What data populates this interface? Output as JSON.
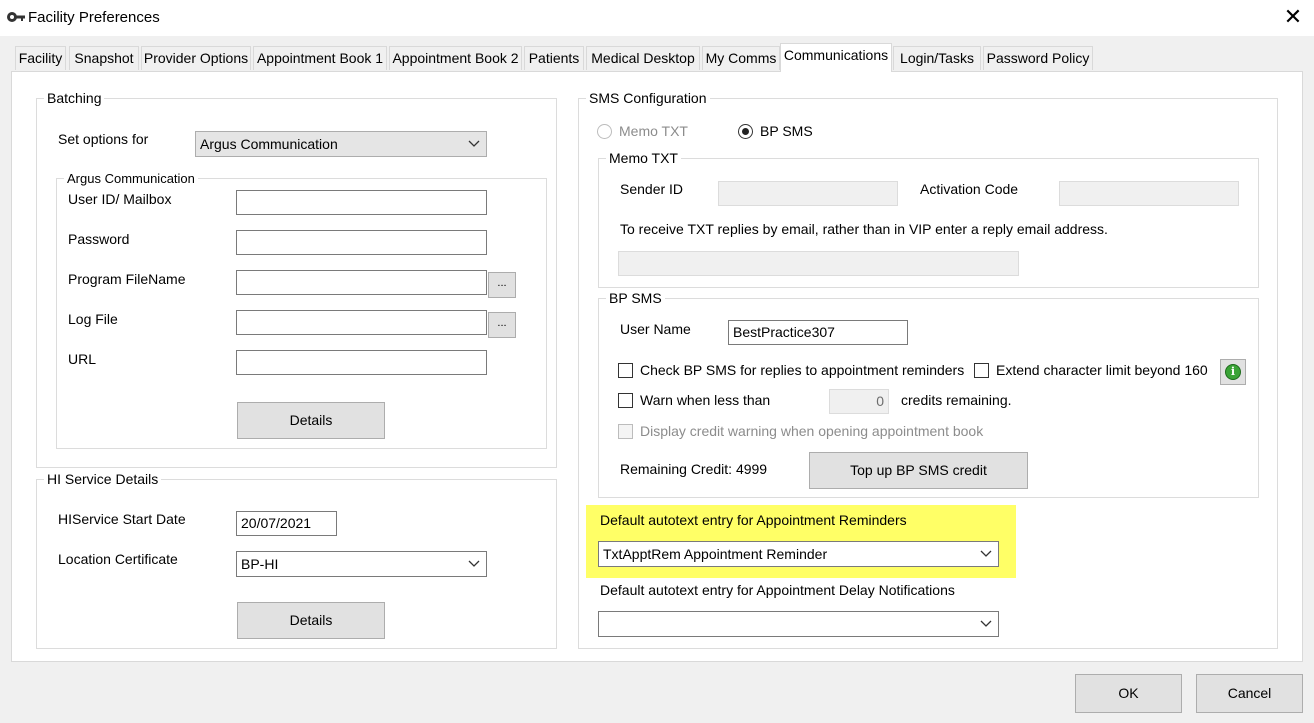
{
  "window": {
    "title": "Facility Preferences",
    "icon": "key-icon",
    "close": "✕"
  },
  "tabs": [
    "Facility",
    "Snapshot",
    "Provider Options",
    "Appointment Book 1",
    "Appointment Book 2",
    "Patients",
    "Medical Desktop",
    "My Comms",
    "Communications",
    "Login/Tasks",
    "Password Policy"
  ],
  "active_tab": "Communications",
  "batching": {
    "title": "Batching",
    "set_options_label": "Set options for",
    "set_options_value": "Argus Communication",
    "argus": {
      "title": "Argus Communication",
      "user_id_label": "User ID/ Mailbox",
      "user_id_value": "",
      "password_label": "Password",
      "password_value": "",
      "program_label": "Program FileName",
      "program_value": "",
      "logfile_label": "Log File",
      "logfile_value": "",
      "url_label": "URL",
      "url_value": "",
      "browse_label": "...",
      "details_label": "Details"
    }
  },
  "hi_service": {
    "title": "HI Service Details",
    "start_date_label": "HIService Start Date",
    "start_date_value": "20/07/2021",
    "location_cert_label": "Location Certificate",
    "location_cert_value": "BP-HI",
    "details_label": "Details"
  },
  "sms": {
    "title": "SMS Configuration",
    "radio_memo": "Memo TXT",
    "radio_bp": "BP SMS",
    "selected": "BP SMS",
    "memo_txt": {
      "title": "Memo TXT",
      "sender_id_label": "Sender ID",
      "sender_id_value": "",
      "activation_label": "Activation Code",
      "activation_value": "",
      "reply_note": "To receive TXT replies by email, rather than in VIP enter a reply email address.",
      "reply_email_value": ""
    },
    "bp_sms": {
      "title": "BP SMS",
      "username_label": "User Name",
      "username_value": "BestPractice307",
      "check_replies_label": "Check BP SMS for replies to appointment reminders",
      "extend_limit_label": "Extend character limit beyond 160",
      "warn_label": "Warn when less than",
      "warn_value": "0",
      "credits_label": "credits remaining.",
      "display_warning_label": "Display credit warning when opening appointment book",
      "remaining_label": "Remaining Credit: 4999",
      "topup_label": "Top up BP SMS credit"
    },
    "reminder_label": "Default autotext entry for Appointment Reminders",
    "reminder_value": "TxtApptRem Appointment Reminder",
    "delay_label": "Default autotext entry for Appointment Delay Notifications",
    "delay_value": ""
  },
  "footer": {
    "ok_label": "OK",
    "cancel_label": "Cancel"
  },
  "colors": {
    "highlight": "#ffff66",
    "panel": "#ffffff",
    "chrome": "#f0f0f0",
    "info": "#3aa336"
  }
}
